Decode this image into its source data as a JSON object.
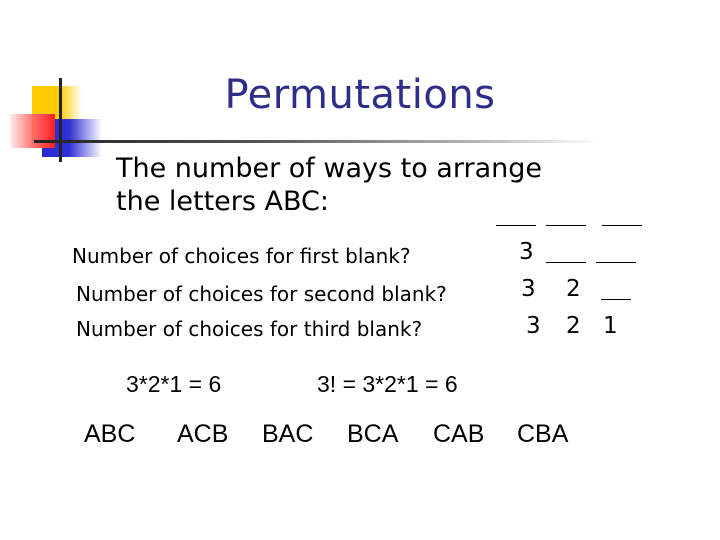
{
  "slide": {
    "title": "Permutations",
    "intro_line1": "The number of ways to arrange",
    "intro_line2": "the letters ABC:",
    "questions": [
      {
        "label": "Number of choices for first blank?",
        "values": [
          "3"
        ]
      },
      {
        "label": "Number of choices for second blank?",
        "values": [
          "3",
          "2"
        ]
      },
      {
        "label": "Number of choices for third blank?",
        "values": [
          "3",
          "2",
          "1"
        ]
      }
    ],
    "product": "3*2*1 = 6",
    "factorial": "3! = 3*2*1 = 6",
    "permutations": [
      "ABC",
      "ACB",
      "BAC",
      "BCA",
      "CAB",
      "CBA"
    ],
    "colors": {
      "title": "#2e2e8a",
      "accent_yellow": "#ffcc00",
      "accent_blue": "#3030d8",
      "accent_red": "#ff2020"
    }
  }
}
